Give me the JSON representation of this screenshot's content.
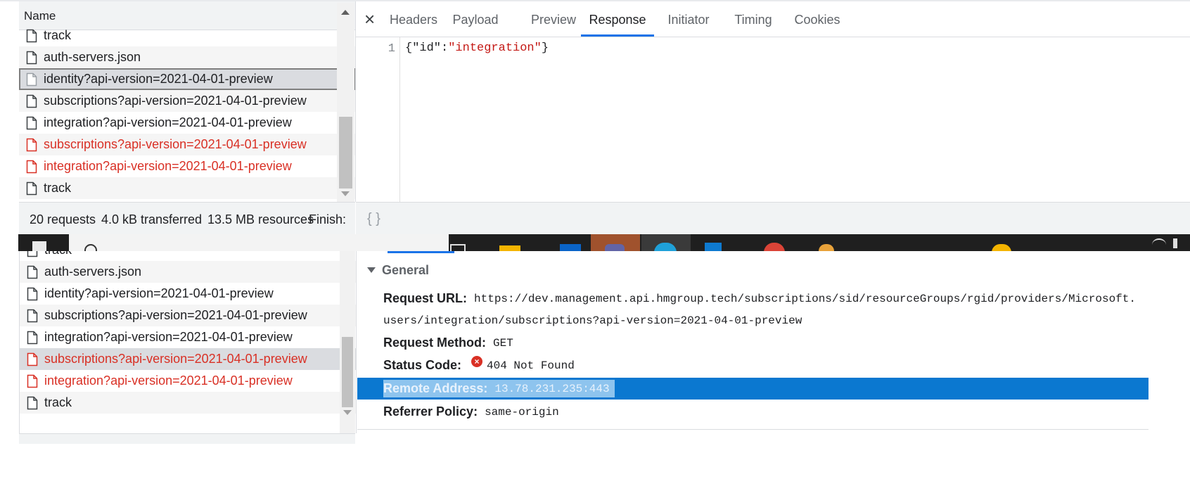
{
  "top_panel": {
    "list_header": "Name",
    "rows": [
      {
        "label": "track",
        "state": "normal"
      },
      {
        "label": "auth-servers.json",
        "state": "alt"
      },
      {
        "label": "identity?api-version=2021-04-01-preview",
        "state": "selected"
      },
      {
        "label": "subscriptions?api-version=2021-04-01-preview",
        "state": "alt"
      },
      {
        "label": "integration?api-version=2021-04-01-preview",
        "state": "normal"
      },
      {
        "label": "subscriptions?api-version=2021-04-01-preview",
        "state": "error-alt"
      },
      {
        "label": "integration?api-version=2021-04-01-preview",
        "state": "error"
      },
      {
        "label": "track",
        "state": "alt"
      }
    ],
    "status_bar": {
      "requests": "20 requests",
      "transferred": "4.0 kB transferred",
      "resources": "13.5 MB resources",
      "finish": "Finish:"
    },
    "tabs": {
      "close_symbol": "×",
      "items": [
        "Headers",
        "Payload",
        "Preview",
        "Response",
        "Initiator",
        "Timing",
        "Cookies"
      ],
      "active": "Response"
    },
    "response": {
      "line_number": "1",
      "open_brace": "{",
      "key": "\"id\"",
      "colon": ":",
      "value": "\"integration\"",
      "close_brace": "}"
    },
    "pretty_print_label": "{ }"
  },
  "bottom_panel": {
    "rows": [
      {
        "label": "track",
        "state": "normal"
      },
      {
        "label": "auth-servers.json",
        "state": "alt"
      },
      {
        "label": "identity?api-version=2021-04-01-preview",
        "state": "normal"
      },
      {
        "label": "subscriptions?api-version=2021-04-01-preview",
        "state": "alt"
      },
      {
        "label": "integration?api-version=2021-04-01-preview",
        "state": "normal"
      },
      {
        "label": "subscriptions?api-version=2021-04-01-preview",
        "state": "error-selected"
      },
      {
        "label": "integration?api-version=2021-04-01-preview",
        "state": "error"
      },
      {
        "label": "track",
        "state": "alt"
      }
    ],
    "general": {
      "title": "General",
      "request_url_label": "Request URL:",
      "request_url_line1": "https://dev.management.api.hmgroup.tech/subscriptions/sid/resourceGroups/rgid/providers/Microsoft.",
      "request_url_line2": "users/integration/subscriptions?api-version=2021-04-01-preview",
      "request_method_label": "Request Method:",
      "request_method": "GET",
      "status_code_label": "Status Code:",
      "status_code": "404 Not Found",
      "remote_address_label": "Remote Address:",
      "remote_address": "13.78.231.235:443",
      "referrer_policy_label": "Referrer Policy:",
      "referrer_policy": "same-origin"
    }
  },
  "colors": {
    "accent": "#1a73e8",
    "error": "#d93025",
    "selection": "#0b78d0",
    "taskbar": "#1f1f1f"
  },
  "taskbar_icons": [
    "windows-icon",
    "search-icon",
    "task-view-icon",
    "file-explorer-icon",
    "outlook-icon",
    "teams-icon",
    "edge-icon",
    "vscode-icon",
    "chrome-icon",
    "paint-icon",
    "app-icon",
    "wifi-icon",
    "volume-icon"
  ]
}
